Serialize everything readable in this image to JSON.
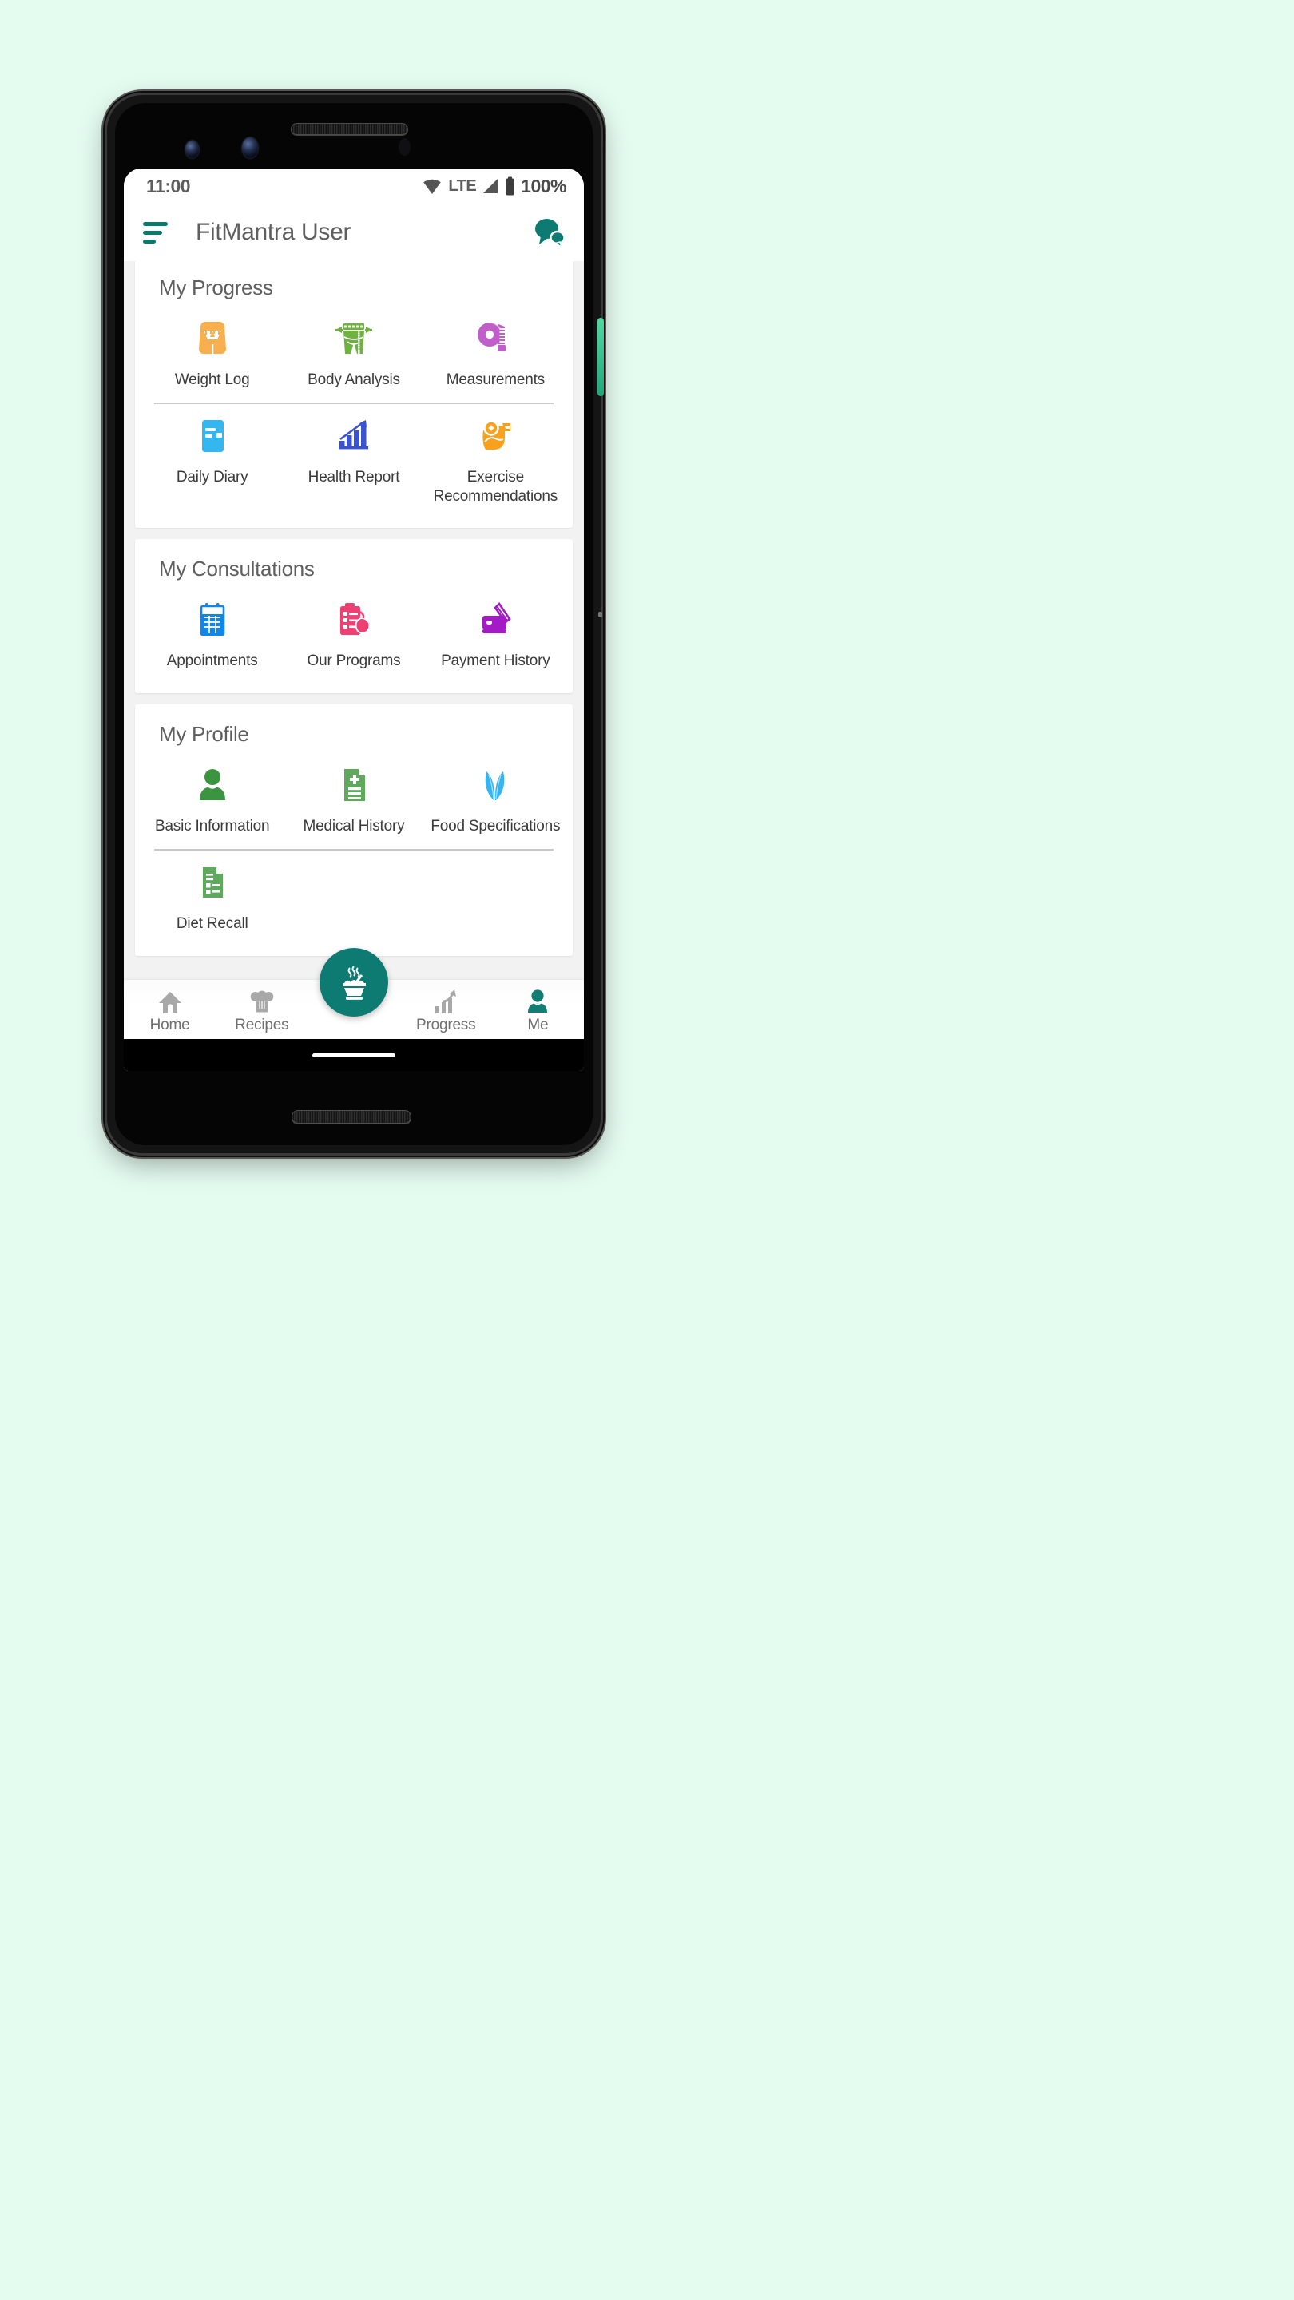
{
  "device": {
    "hardware": {
      "camera_1": "front-camera-lens",
      "camera_2": "front-camera-lens-secondary",
      "sensor": "proximity-sensor",
      "earpiece": "earpiece-speaker",
      "bottom_speaker": "bottom-speaker-grille",
      "side_button": "side-power-button",
      "gesture_bar": "home-gesture-indicator"
    }
  },
  "statusbar": {
    "time": "11:00",
    "network_label": "LTE",
    "battery_text": "100%",
    "wifi_icon": "wifi-icon",
    "signal_icon": "cellular-signal-icon",
    "battery_icon": "battery-full-icon"
  },
  "appbar": {
    "menu_icon": "hamburger-menu-icon",
    "title": "FitMantra User",
    "chat_icon": "chat-bubbles-icon"
  },
  "colors": {
    "brand_teal": "#0d7b72",
    "page_bg": "#e4fbf0",
    "card_bg": "#ffffff",
    "screen_bg": "#f2f2f2",
    "orange": "#f8b04e",
    "green": "#6fb23f",
    "orchid": "#c05fc9",
    "sky_blue": "#35b6ef",
    "indigo": "#3a53d0",
    "amber": "#f9a11b",
    "blue": "#1286e8",
    "pink": "#ef4073",
    "purple": "#a31bc4",
    "leaf_green": "#3d9440",
    "doc_green": "#5fa95c",
    "leaf_blue": "#36b4ef",
    "nav_gray": "#a8a8a8"
  },
  "sections": [
    {
      "title": "My Progress",
      "rows": [
        {
          "tiles": [
            {
              "label": "Weight Log",
              "icon": "weight-scale-icon"
            },
            {
              "label": "Body Analysis",
              "icon": "body-measure-icon"
            },
            {
              "label": "Measurements",
              "icon": "tape-measure-icon"
            }
          ]
        },
        {
          "divider": true,
          "tiles": [
            {
              "label": "Daily Diary",
              "icon": "notebook-icon"
            },
            {
              "label": "Health Report",
              "icon": "bar-chart-arrow-icon"
            },
            {
              "label": "Exercise Recommendations",
              "icon": "flexed-bicep-icon"
            }
          ]
        }
      ]
    },
    {
      "title": "My Consultations",
      "rows": [
        {
          "tiles": [
            {
              "label": "Appointments",
              "icon": "calendar-icon"
            },
            {
              "label": "Our Programs",
              "icon": "clipboard-apple-icon"
            },
            {
              "label": "Payment History",
              "icon": "wallet-card-icon"
            }
          ]
        }
      ]
    },
    {
      "title": "My Profile",
      "rows": [
        {
          "tiles": [
            {
              "label": "Basic Information",
              "icon": "person-icon"
            },
            {
              "label": "Medical History",
              "icon": "medical-document-icon"
            },
            {
              "label": "Food Specifications",
              "icon": "leaves-icon"
            }
          ]
        },
        {
          "divider": true,
          "tiles": [
            {
              "label": "Diet Recall",
              "icon": "checklist-document-icon"
            }
          ]
        }
      ]
    }
  ],
  "bottomnav": {
    "fab_icon": "steaming-bowl-icon",
    "items": [
      {
        "label": "Home",
        "icon": "home-icon",
        "active": false
      },
      {
        "label": "Recipes",
        "icon": "chef-hat-icon",
        "active": false
      },
      {
        "label": "Progress",
        "icon": "progress-chart-icon",
        "active": false
      },
      {
        "label": "Me",
        "icon": "person-icon",
        "active": true
      }
    ]
  }
}
